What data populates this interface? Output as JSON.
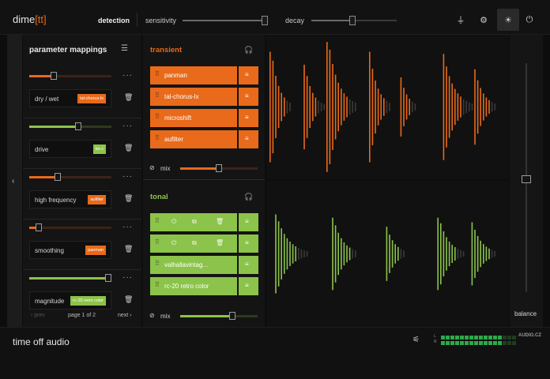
{
  "header": {
    "logo_main": "dime",
    "logo_bracket": "[tt]",
    "detection": "detection",
    "sensitivity": "sensitivity",
    "decay": "decay",
    "sensitivity_value": 0.95,
    "decay_value": 0.48
  },
  "params": {
    "title": "parameter mappings",
    "items": [
      {
        "label": "dry / wet",
        "tag": "tal-chorus-lx",
        "color": "orange",
        "value": 0.3
      },
      {
        "label": "drive",
        "tag": "bx-c",
        "color": "green",
        "value": 0.6
      },
      {
        "label": "high frequency",
        "tag": "aufilter",
        "color": "orange",
        "value": 0.35
      },
      {
        "label": "smoothing",
        "tag": "panman",
        "color": "orange",
        "value": 0.12
      },
      {
        "label": "magnitude",
        "tag": "rc-20 retro color",
        "color": "green",
        "value": 0.95
      }
    ],
    "prev": "prev",
    "page": "page 1 of 2",
    "next": "next"
  },
  "transient": {
    "title": "transient",
    "fx": [
      "panman",
      "tal-chorus-lx",
      "microshift",
      "aufilter"
    ],
    "mix_label": "mix",
    "mix_value": 0.5
  },
  "tonal": {
    "title": "tonal",
    "fx": [
      "",
      "",
      "valhallavintag...",
      "rc-20 retro color"
    ],
    "mix_label": "mix",
    "mix_value": 0.67
  },
  "balance": {
    "label": "balance",
    "value": 0.5
  },
  "footer": {
    "brand": "time off audio",
    "meter_l": "L",
    "meter_r": "R",
    "watermark": "AUDIO.CZ"
  },
  "colors": {
    "accent_orange": "#e86a1a",
    "accent_green": "#8cc34a"
  }
}
